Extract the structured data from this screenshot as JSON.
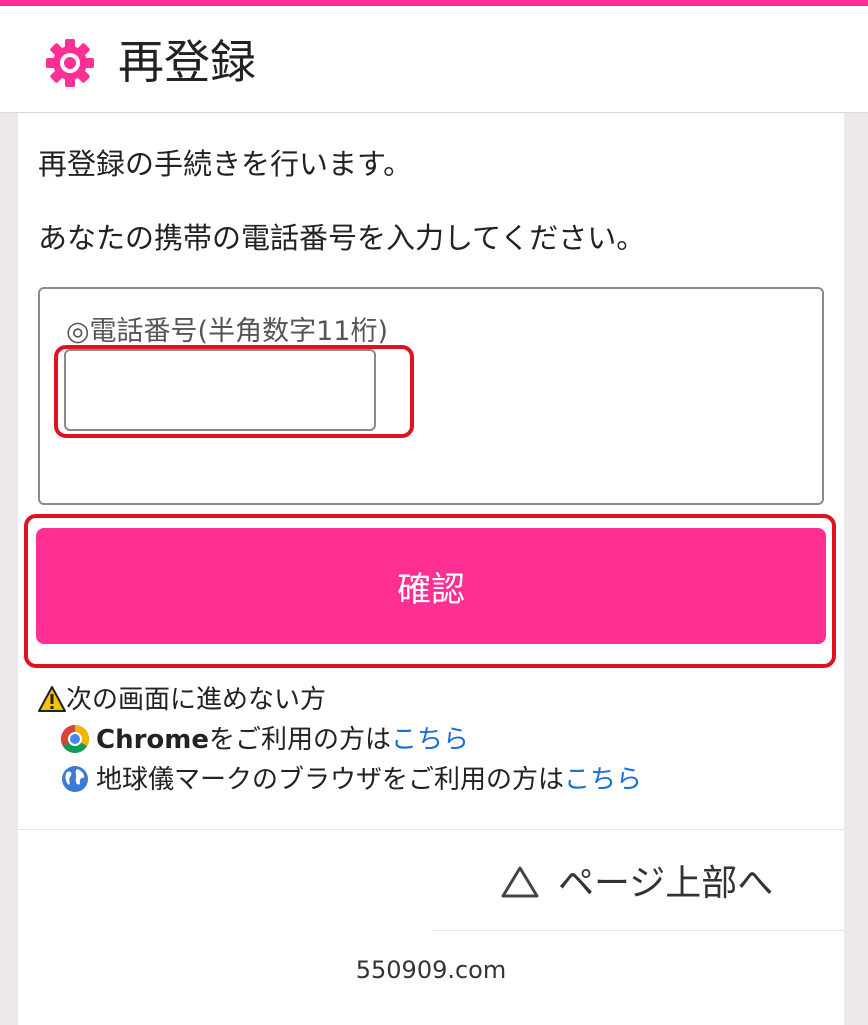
{
  "header": {
    "title": "再登録",
    "icon": "gear-icon"
  },
  "main": {
    "intro": "再登録の手続きを行います。",
    "instruction": "あなたの携帯の電話番号を入力してください。",
    "phone_field": {
      "label": "◎電話番号(半角数字11桁)",
      "value": "",
      "placeholder": ""
    },
    "confirm_label": "確認"
  },
  "help": {
    "heading": "次の画面に進めない方",
    "chrome": {
      "prefix": "Chrome",
      "text": "をご利用の方は",
      "link": "こちら"
    },
    "globe": {
      "text": "地球儀マークのブラウザをご利用の方は",
      "link": "こちら"
    }
  },
  "footer": {
    "page_top": "ページ上部へ",
    "domain": "550909.com"
  },
  "colors": {
    "accent": "#ff2f93",
    "highlight": "#e0121f",
    "link": "#1a6fd6"
  }
}
